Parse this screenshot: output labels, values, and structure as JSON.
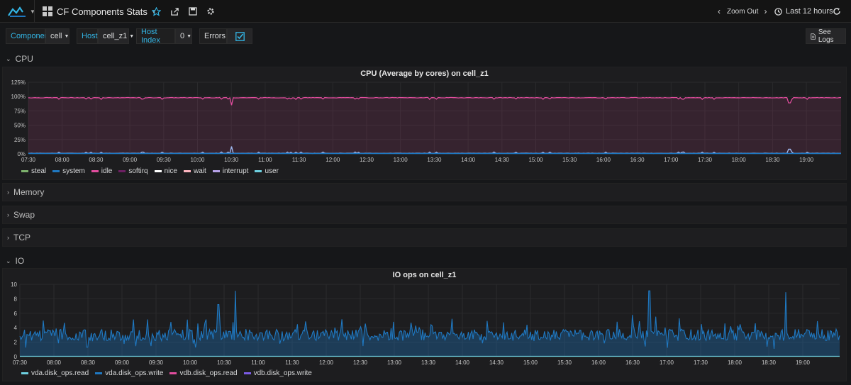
{
  "header": {
    "dashboard_title": "CF Components Stats",
    "zoom_out": "Zoom Out",
    "time_range": "Last 12 hours"
  },
  "variables": {
    "component_label": "Component",
    "component_value": "cell",
    "host_label": "Host",
    "host_value": "cell_z1",
    "host_index_label": "Host Index",
    "host_index_value": "0",
    "errors_label": "Errors",
    "see_logs": "See Logs"
  },
  "rows": {
    "cpu": "CPU",
    "memory": "Memory",
    "swap": "Swap",
    "tcp": "TCP",
    "io": "IO"
  },
  "colors": {
    "accent": "#33b5e5",
    "idle": "#e24d9e",
    "io_read": "#1f78c1"
  },
  "chart_data": [
    {
      "type": "line",
      "title": "CPU (Average by cores) on cell_z1",
      "yticks": [
        "125%",
        "100%",
        "75%",
        "50%",
        "25%",
        "0%"
      ],
      "ylim": [
        0,
        125
      ],
      "x": [
        "07:30",
        "08:00",
        "08:30",
        "09:00",
        "09:30",
        "10:00",
        "10:30",
        "11:00",
        "11:30",
        "12:00",
        "12:30",
        "13:00",
        "13:30",
        "14:00",
        "14:30",
        "15:00",
        "15:30",
        "16:00",
        "16:30",
        "17:00",
        "17:30",
        "18:00",
        "18:30",
        "19:00"
      ],
      "grid": true,
      "series": [
        {
          "name": "steal",
          "color": "#7eb26d",
          "approx": 0
        },
        {
          "name": "system",
          "color": "#1f78c1",
          "approx": 1
        },
        {
          "name": "idle",
          "color": "#e24d9e",
          "approx": 98
        },
        {
          "name": "softirq",
          "color": "#6d1f62",
          "approx": 0
        },
        {
          "name": "nice",
          "color": "#ffffff",
          "approx": 0
        },
        {
          "name": "wait",
          "color": "#ffb6c1",
          "approx": 0
        },
        {
          "name": "interrupt",
          "color": "#b7a2e8",
          "approx": 0
        },
        {
          "name": "user",
          "color": "#6ed0e0",
          "approx": 1
        }
      ],
      "spikes": [
        {
          "at": "10:30",
          "idle": 85,
          "user": 13
        },
        {
          "at": "18:45",
          "idle": 89,
          "user": 8
        }
      ]
    },
    {
      "type": "area",
      "title": "IO ops on cell_z1",
      "yticks": [
        "10",
        "8",
        "6",
        "4",
        "2",
        "0"
      ],
      "ylim": [
        0,
        10
      ],
      "x": [
        "07:30",
        "08:00",
        "08:30",
        "09:00",
        "09:30",
        "10:00",
        "10:30",
        "11:00",
        "11:30",
        "12:00",
        "12:30",
        "13:00",
        "13:30",
        "14:00",
        "14:30",
        "15:00",
        "15:30",
        "16:00",
        "16:30",
        "17:00",
        "17:30",
        "18:00",
        "18:30",
        "19:00"
      ],
      "grid": true,
      "series": [
        {
          "name": "vda.disk_ops.read",
          "color": "#6ed0e0"
        },
        {
          "name": "vda.disk_ops.write",
          "color": "#1f78c1"
        },
        {
          "name": "vdb.disk_ops.read",
          "color": "#e24d9e"
        },
        {
          "name": "vdb.disk_ops.write",
          "color": "#7c5ce6"
        }
      ],
      "baseline": 3,
      "spikes": [
        {
          "at": "10:25",
          "value": 7.2
        },
        {
          "at": "10:40",
          "value": 9.1
        },
        {
          "at": "16:45",
          "value": 9.1
        },
        {
          "at": "18:45",
          "value": 8.9
        }
      ]
    }
  ]
}
